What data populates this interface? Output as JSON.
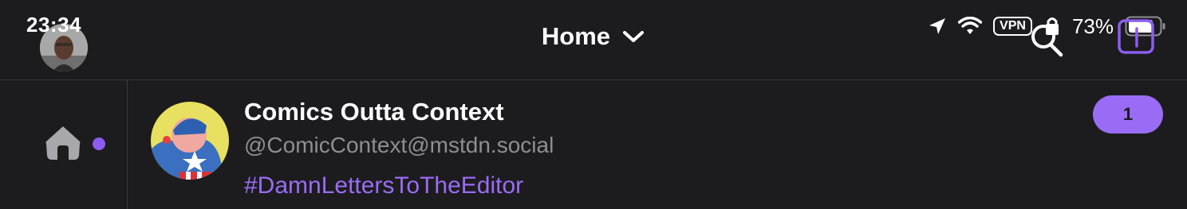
{
  "status_bar": {
    "time": "23:34",
    "vpn_label": "VPN",
    "battery_percent": "73%"
  },
  "header": {
    "title": "Home"
  },
  "feed": {
    "items": [
      {
        "display_name": "Comics Outta Context",
        "handle": "@ComicContext@mstdn.social",
        "hashtag": "#DamnLettersToTheEditor",
        "count": "1"
      }
    ]
  },
  "colors": {
    "background": "#1c1c1e",
    "accent": "#9a6cf5",
    "divider": "#3a3a3c",
    "secondary_text": "#8e8e93"
  },
  "icons": {
    "location": "location-arrow-icon",
    "wifi": "wifi-icon",
    "battery": "battery-icon",
    "search": "search-icon",
    "compose": "compose-icon",
    "home": "home-icon",
    "chevron": "chevron-down-icon"
  }
}
